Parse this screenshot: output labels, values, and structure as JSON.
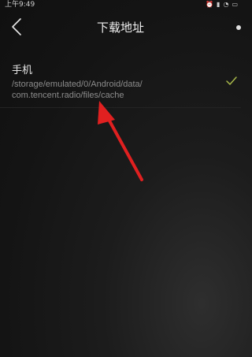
{
  "status_bar": {
    "time": "上午9:49"
  },
  "header": {
    "title": "下载地址"
  },
  "storage_option": {
    "name": "手机",
    "path_line1": "/storage/emulated/0/Android/data/",
    "path_line2": "com.tencent.radio/files/cache",
    "selected": true
  },
  "colors": {
    "accent_check": "#a8b84a",
    "arrow": "#e02020"
  }
}
